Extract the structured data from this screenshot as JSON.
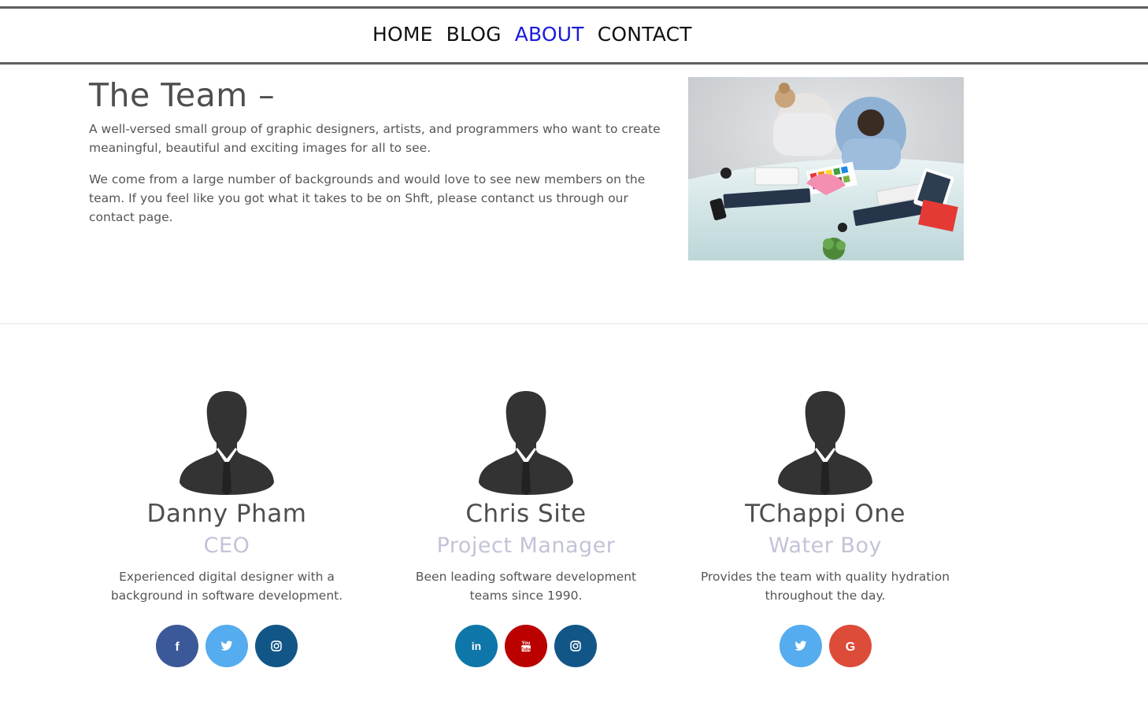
{
  "nav": {
    "items": [
      {
        "label": "HOME",
        "active": false
      },
      {
        "label": "BLOG",
        "active": false
      },
      {
        "label": "ABOUT",
        "active": true
      },
      {
        "label": "CONTACT",
        "active": false
      }
    ],
    "active_color": "#1a1adc"
  },
  "intro": {
    "title": "The Team –",
    "paragraphs": [
      "A well-versed small group of graphic designers, artists, and programmers who want to create meaningful, beautiful and exciting images for all to see.",
      "We come from a large number of backgrounds and would love to see new members on the team. If you feel like you got what it takes to be on Shft, please contanct us through our contact page."
    ]
  },
  "team": [
    {
      "name": "Danny Pham",
      "role": "CEO",
      "bio": "Experienced digital designer with a background in software development.",
      "socials": [
        {
          "icon": "facebook-icon",
          "color": "#3b5998"
        },
        {
          "icon": "twitter-icon",
          "color": "#55acee"
        },
        {
          "icon": "instagram-icon",
          "color": "#125688"
        }
      ]
    },
    {
      "name": "Chris Site",
      "role": "Project Manager",
      "bio": "Been leading software development teams since 1990.",
      "socials": [
        {
          "icon": "linkedin-icon",
          "color": "#0e76a8"
        },
        {
          "icon": "youtube-icon",
          "color": "#bb0000"
        },
        {
          "icon": "instagram-icon",
          "color": "#125688"
        }
      ]
    },
    {
      "name": "TChappi One",
      "role": "Water Boy",
      "bio": "Provides the team with quality hydration throughout the day.",
      "socials": [
        {
          "icon": "twitter-icon",
          "color": "#55acee"
        },
        {
          "icon": "google-icon",
          "color": "#dd4b39"
        }
      ]
    }
  ],
  "colors": {
    "nav_border": "#5f5f5f",
    "role_text": "#c3c3d8",
    "avatar": "#333333"
  }
}
